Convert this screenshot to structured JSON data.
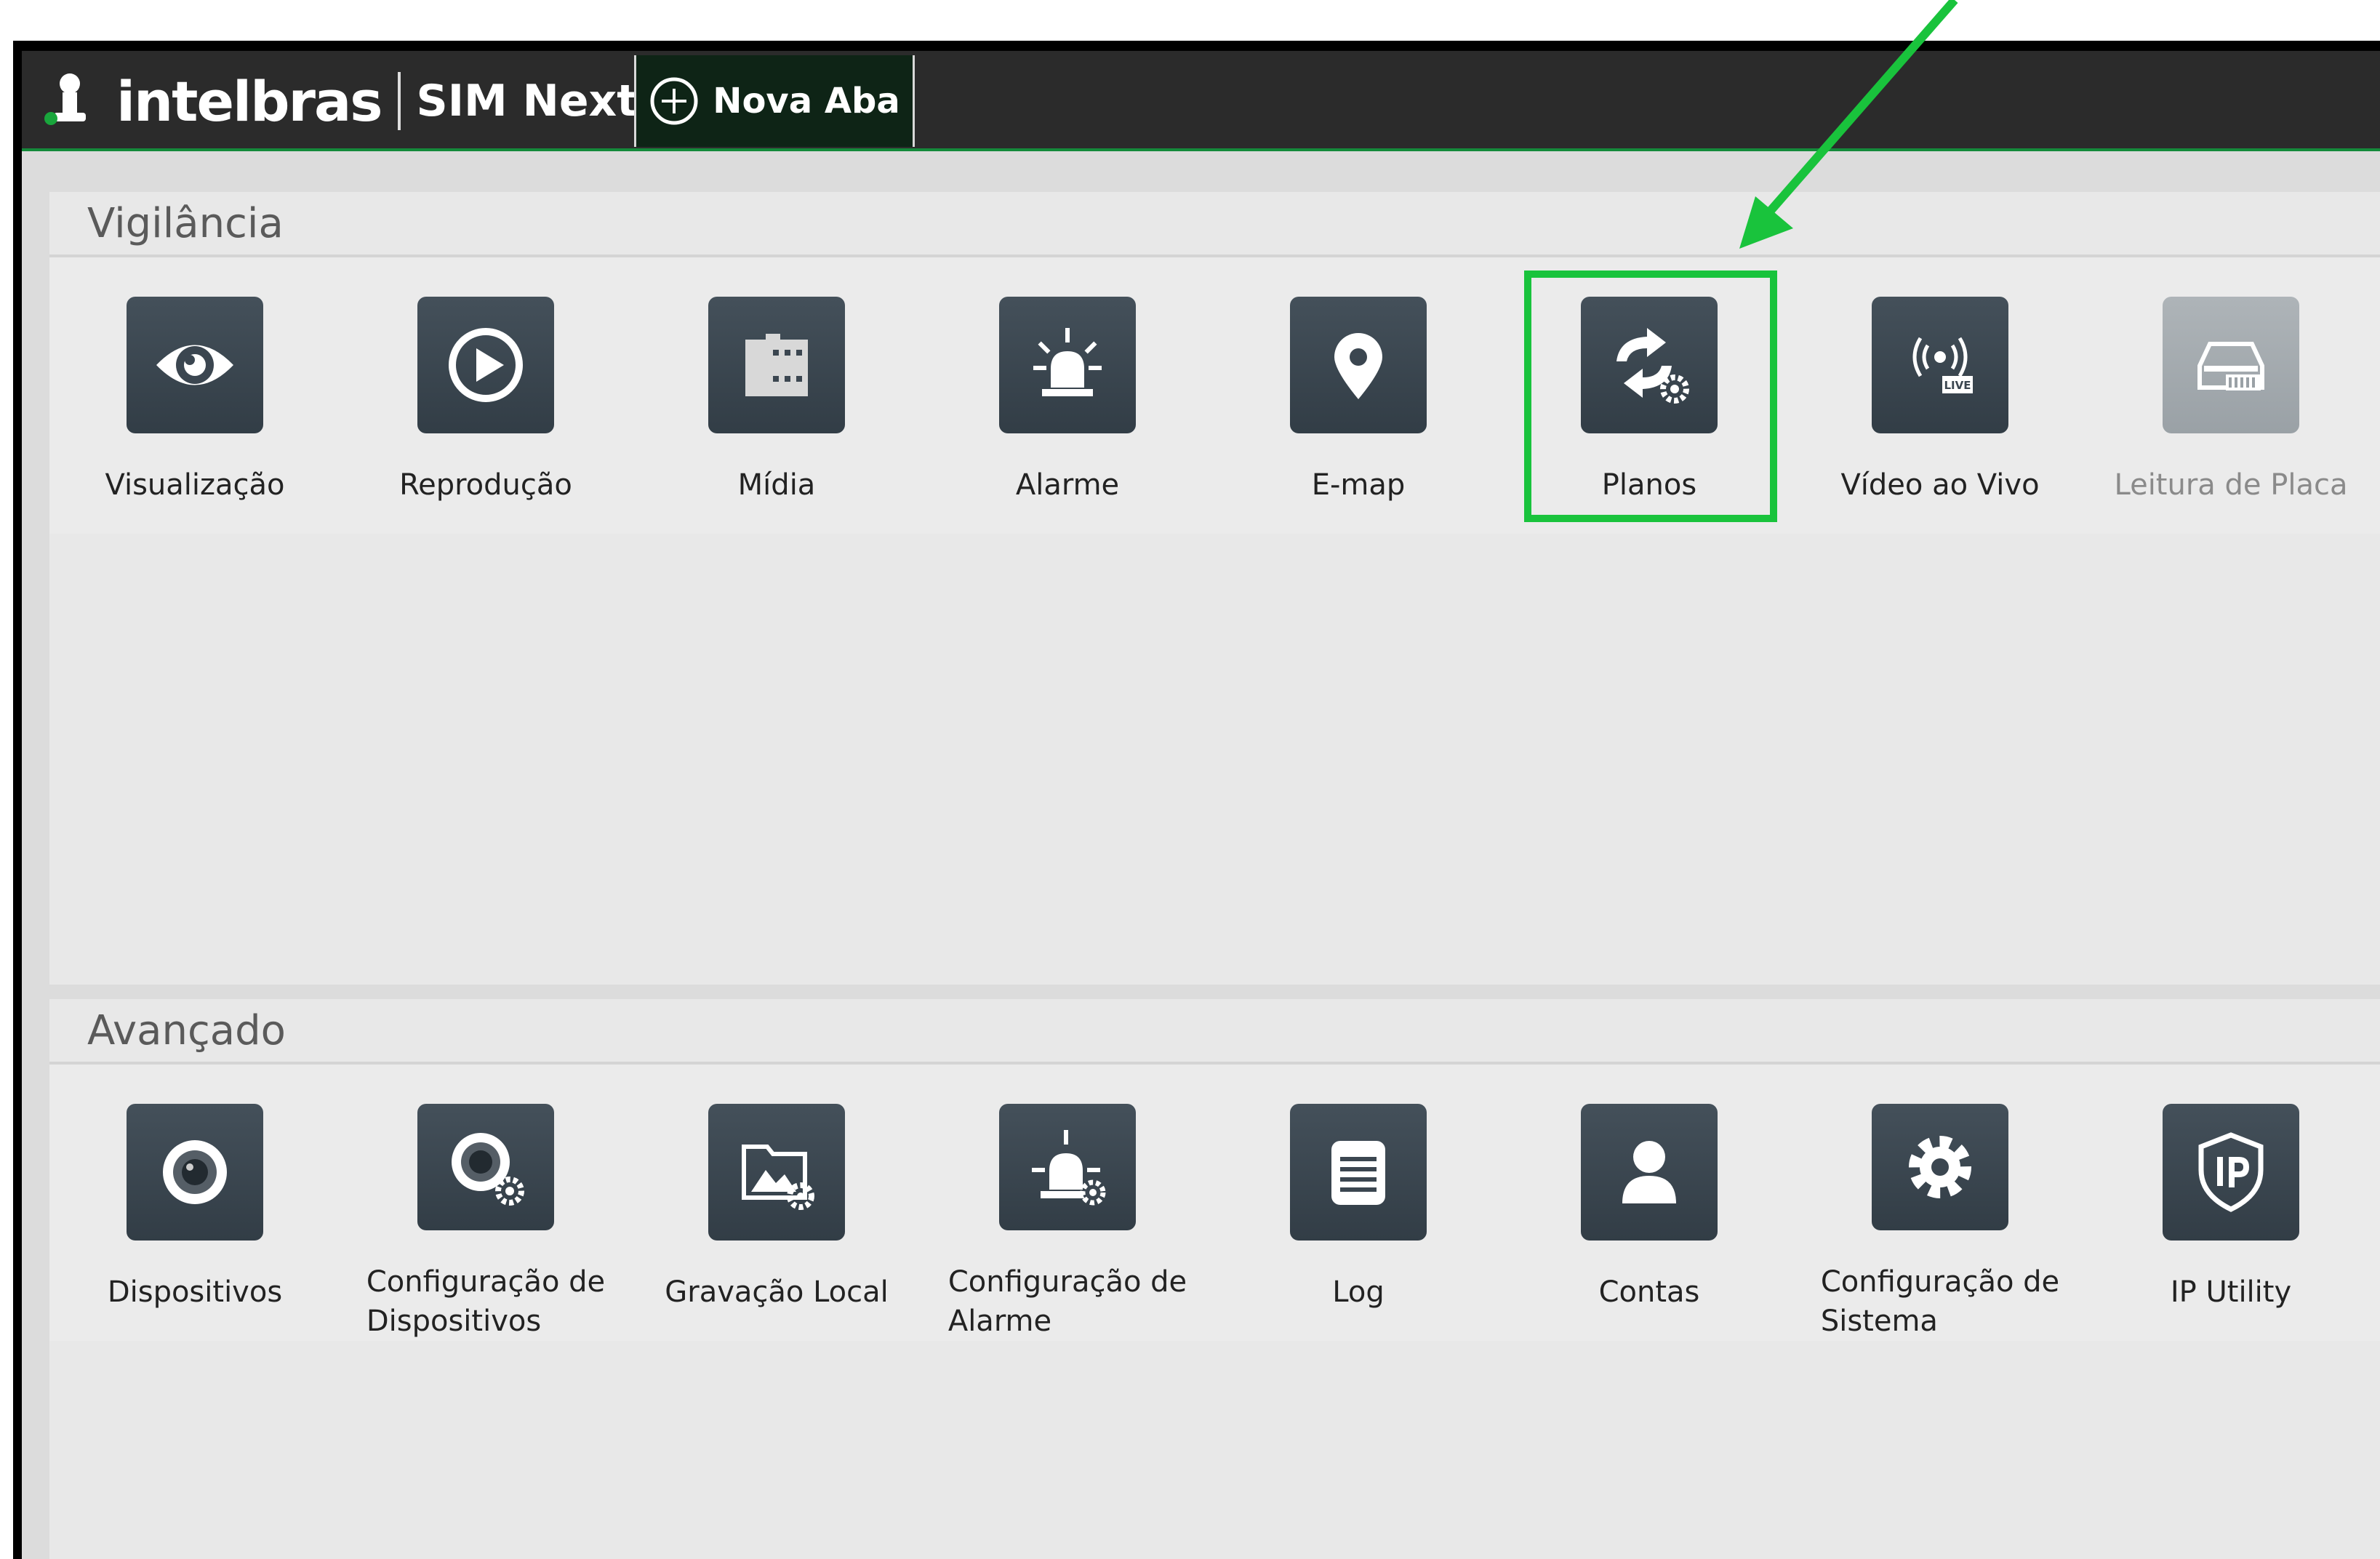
{
  "window": {
    "brand": "intelbras",
    "product": "SIM Next",
    "new_tab_label": "Nova Aba"
  },
  "colors": {
    "titlebar": "#2b2b2b",
    "accent_green": "#19c33c",
    "tile": "#3b4650",
    "panel": "#e8e8e8"
  },
  "sections": [
    {
      "title": "Vigilância",
      "items": [
        {
          "label": "Visualização",
          "icon": "eye-icon"
        },
        {
          "label": "Reprodução",
          "icon": "play-icon"
        },
        {
          "label": "Mídia",
          "icon": "film-icon"
        },
        {
          "label": "Alarme",
          "icon": "siren-icon"
        },
        {
          "label": "E-map",
          "icon": "map-pin-icon"
        },
        {
          "label": "Planos",
          "icon": "sync-gear-icon"
        },
        {
          "label": "Vídeo ao Vivo",
          "icon": "live-broadcast-icon"
        },
        {
          "label": "Leitura de Placa",
          "icon": "car-plate-icon",
          "disabled": true
        }
      ]
    },
    {
      "title": "Avançado",
      "items": [
        {
          "label": "Dispositivos",
          "icon": "camera-icon"
        },
        {
          "label": "Configuração de\nDispositivos",
          "icon": "camera-gear-icon"
        },
        {
          "label": "Gravação Local",
          "icon": "folder-image-gear-icon"
        },
        {
          "label": "Configuração de\nAlarme",
          "icon": "siren-gear-icon"
        },
        {
          "label": "Log",
          "icon": "log-list-icon"
        },
        {
          "label": "Contas",
          "icon": "user-icon"
        },
        {
          "label": "Configuração de\nSistema",
          "icon": "gear-icon"
        },
        {
          "label": "IP Utility",
          "icon": "ip-shield-icon"
        }
      ]
    }
  ]
}
